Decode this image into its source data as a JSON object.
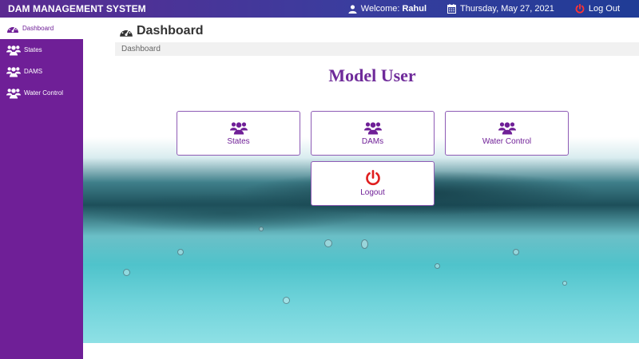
{
  "header": {
    "brand": "DAM MANAGEMENT SYSTEM",
    "welcome_prefix": "Welcome:",
    "user_name": "Rahul",
    "date": "Thursday, May 27, 2021",
    "logout_label": "Log Out"
  },
  "sidebar": {
    "items": [
      {
        "label": "Dashboard",
        "icon": "dashboard-icon",
        "active": true
      },
      {
        "label": "States",
        "icon": "users-icon"
      },
      {
        "label": "DAMS",
        "icon": "users-icon"
      },
      {
        "label": "Water Control",
        "icon": "users-icon"
      }
    ]
  },
  "main": {
    "title": "Dashboard",
    "breadcrumb": "Dashboard",
    "heading": "Model User",
    "tiles": [
      {
        "label": "States",
        "icon": "users-icon"
      },
      {
        "label": "DAMs",
        "icon": "users-icon"
      },
      {
        "label": "Water Control",
        "icon": "users-icon"
      },
      {
        "label": "Logout",
        "icon": "power-icon"
      }
    ]
  },
  "colors": {
    "sidebar": "#6f1f97",
    "accent": "#6f2b9a",
    "logout_red": "#e02020"
  }
}
